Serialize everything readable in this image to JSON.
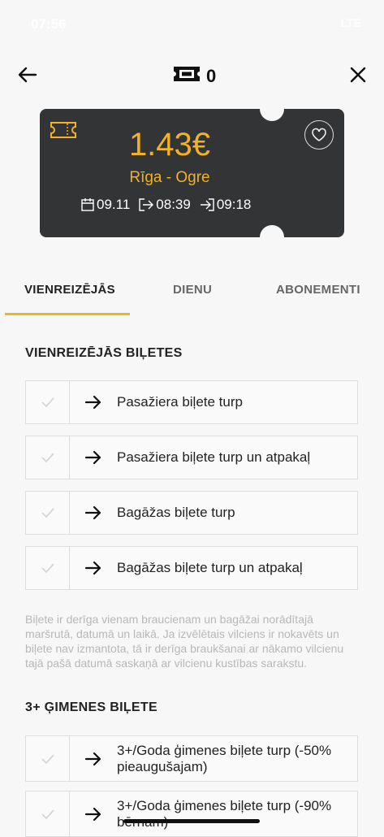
{
  "status": {
    "time": "07:56",
    "signal": "LTE"
  },
  "header": {
    "cart_count": "0"
  },
  "ticket": {
    "price": "1.43€",
    "route": "Rīga - Ogre",
    "date": "09.11",
    "departure": "08:39",
    "arrival": "09:18"
  },
  "tabs": [
    {
      "label": "VIENREIZĒJĀS"
    },
    {
      "label": "DIENU"
    },
    {
      "label": "ABONEMENTI"
    }
  ],
  "sections": [
    {
      "title": "VIENREIZĒJĀS BIĻETES",
      "items": [
        {
          "label": "Pasažiera biļete turp"
        },
        {
          "label": "Pasažiera biļete turp un atpakaļ"
        },
        {
          "label": "Bagāžas biļete turp"
        },
        {
          "label": "Bagāžas biļete turp un atpakaļ"
        }
      ],
      "note": "Biļete ir derīga vienam braucienam un bagāžai norādītajā maršrutā, datumā un laikā. Ja izvēlētais vilciens ir nokavēts un biļete nav izmantota, tā ir derīga braukšanai ar nākamo vilcienu tajā pašā datumā saskaņā ar vilcienu kustības sarakstu."
    },
    {
      "title": "3+ ĢIMENES BIĻETE",
      "items": [
        {
          "label": "3+/Goda ģimenes biļete turp (-50% pieaugušajam)"
        },
        {
          "label": "3+/Goda ģimenes biļete turp (-90% bērnam)"
        }
      ]
    }
  ],
  "colors": {
    "accent": "#f2b224",
    "ticket_bg": "#323436"
  }
}
